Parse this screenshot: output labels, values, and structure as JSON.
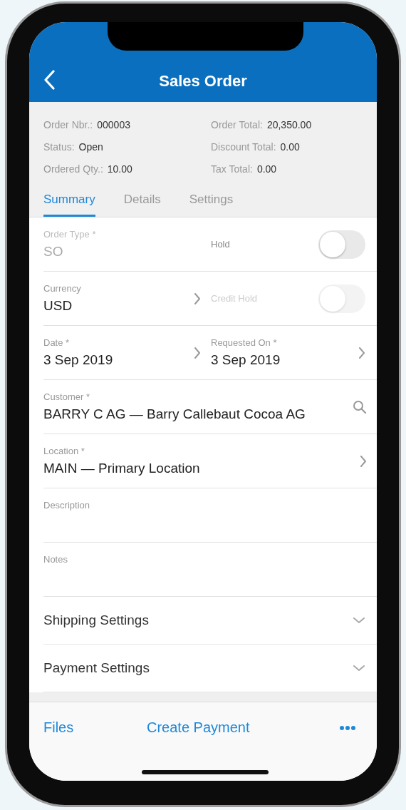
{
  "header": {
    "title": "Sales Order"
  },
  "summary": {
    "left": [
      {
        "label": "Order Nbr.:",
        "value": "000003"
      },
      {
        "label": "Status:",
        "value": "Open"
      },
      {
        "label": "Ordered Qty.:",
        "value": "10.00"
      }
    ],
    "right": [
      {
        "label": "Order Total:",
        "value": "20,350.00"
      },
      {
        "label": "Discount Total:",
        "value": "0.00"
      },
      {
        "label": "Tax Total:",
        "value": "0.00"
      }
    ]
  },
  "tabs": [
    {
      "label": "Summary",
      "selected": true
    },
    {
      "label": "Details",
      "selected": false
    },
    {
      "label": "Settings",
      "selected": false
    }
  ],
  "rows": [
    {
      "cells": [
        {
          "kind": "field",
          "label": "Order Type *",
          "value": "SO",
          "disabled": true
        },
        {
          "kind": "toggle",
          "label": "Hold",
          "on": false,
          "disabled": false
        }
      ]
    },
    {
      "cells": [
        {
          "kind": "picker",
          "label": "Currency",
          "value": "USD",
          "disabled": false
        },
        {
          "kind": "toggle",
          "label": "Credit Hold",
          "on": false,
          "disabled": true
        }
      ]
    },
    {
      "cells": [
        {
          "kind": "picker",
          "label": "Date *",
          "value": "3 Sep 2019",
          "disabled": false
        },
        {
          "kind": "picker",
          "label": "Requested On *",
          "value": "3 Sep 2019",
          "disabled": false
        }
      ]
    },
    {
      "cells": [
        {
          "kind": "lookup",
          "label": "Customer *",
          "value": "BARRY C AG — Barry Callebaut Cocoa AG",
          "disabled": false
        }
      ]
    },
    {
      "cells": [
        {
          "kind": "picker",
          "label": "Location *",
          "value": "MAIN — Primary Location",
          "disabled": false
        }
      ]
    },
    {
      "cells": [
        {
          "kind": "field",
          "label": "Description"
        }
      ]
    },
    {
      "cells": [
        {
          "kind": "field",
          "label": "Notes"
        }
      ]
    }
  ],
  "sections": [
    {
      "label": "Shipping Settings",
      "expanded": false
    },
    {
      "label": "Payment Settings",
      "expanded": false
    }
  ],
  "footer": {
    "actions": [
      {
        "kind": "text",
        "label": "Files"
      },
      {
        "kind": "text",
        "label": "Create Payment"
      },
      {
        "kind": "more"
      }
    ]
  }
}
